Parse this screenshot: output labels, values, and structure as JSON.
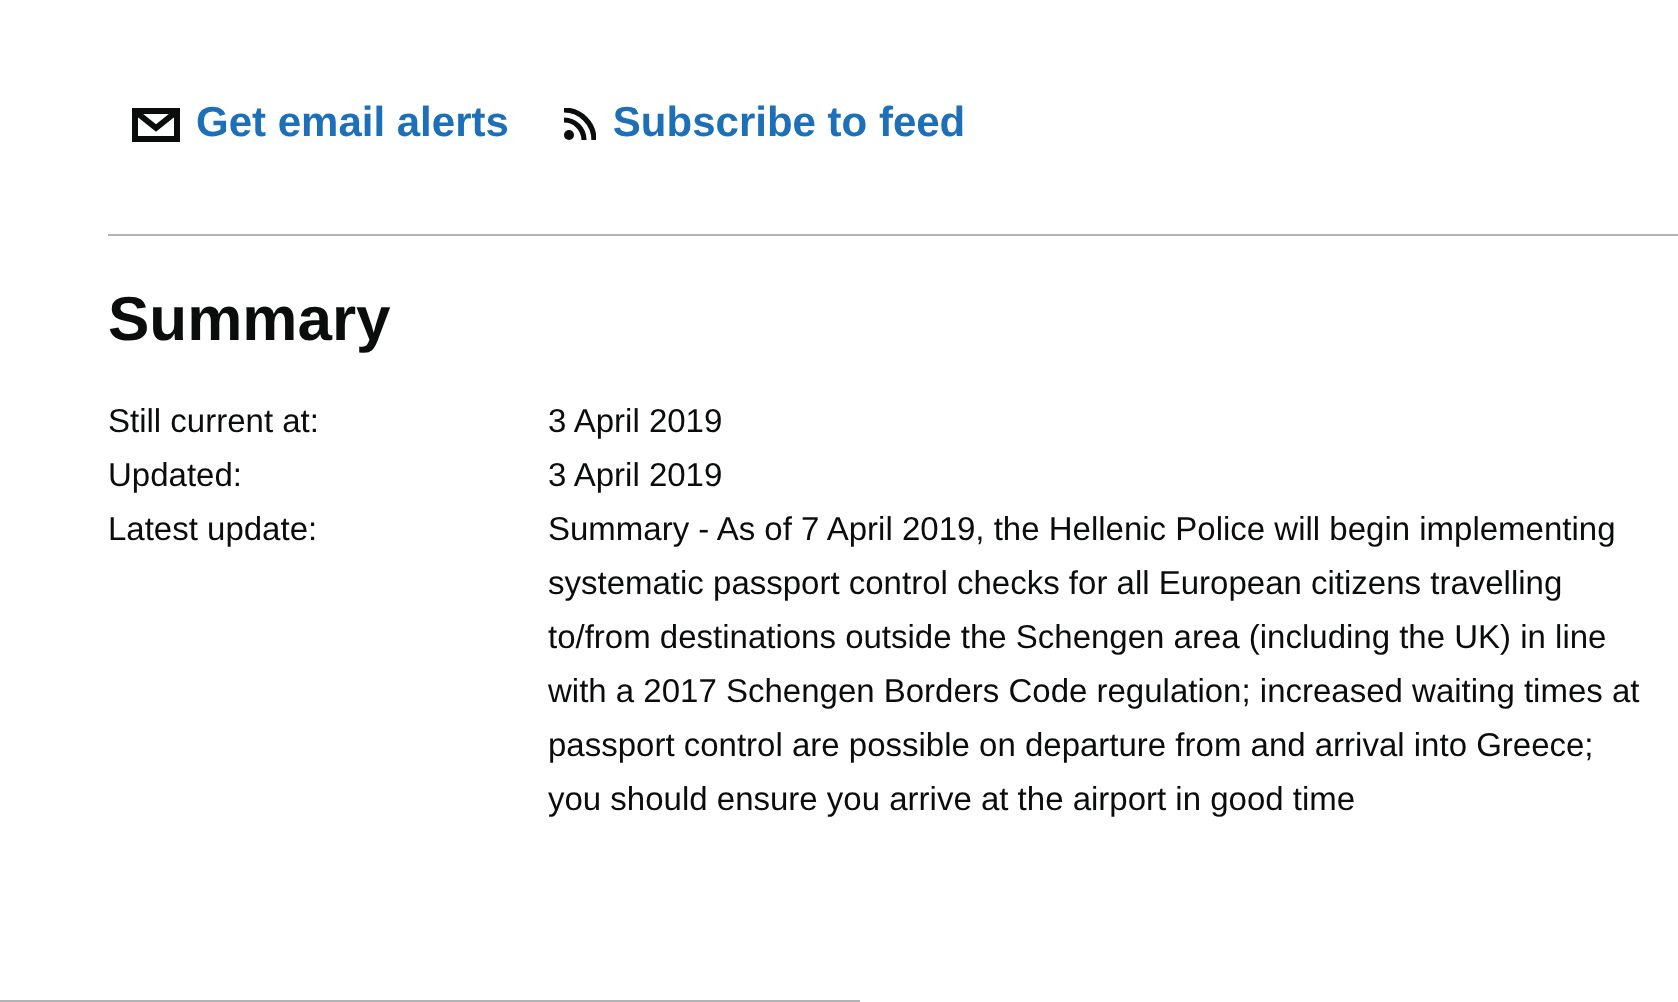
{
  "links": [
    {
      "kind": "email",
      "label": "Get email alerts"
    },
    {
      "kind": "feed",
      "label": "Subscribe to feed"
    }
  ],
  "summary": {
    "title": "Summary",
    "rows": [
      {
        "label": "Still current at:",
        "value": "3 April 2019"
      },
      {
        "label": "Updated:",
        "value": "3 April 2019"
      },
      {
        "label": "Latest update:",
        "value": "Summary - As of 7 April 2019, the Hellenic Police will begin implementing systematic passport control checks for all European citizens travelling to/from destinations outside the Schengen area (including the UK) in line with a 2017 Schengen Borders Code regulation; increased waiting times at passport control are possible on departure from and arrival into Greece; you should ensure you arrive at the airport in good time"
      }
    ]
  }
}
